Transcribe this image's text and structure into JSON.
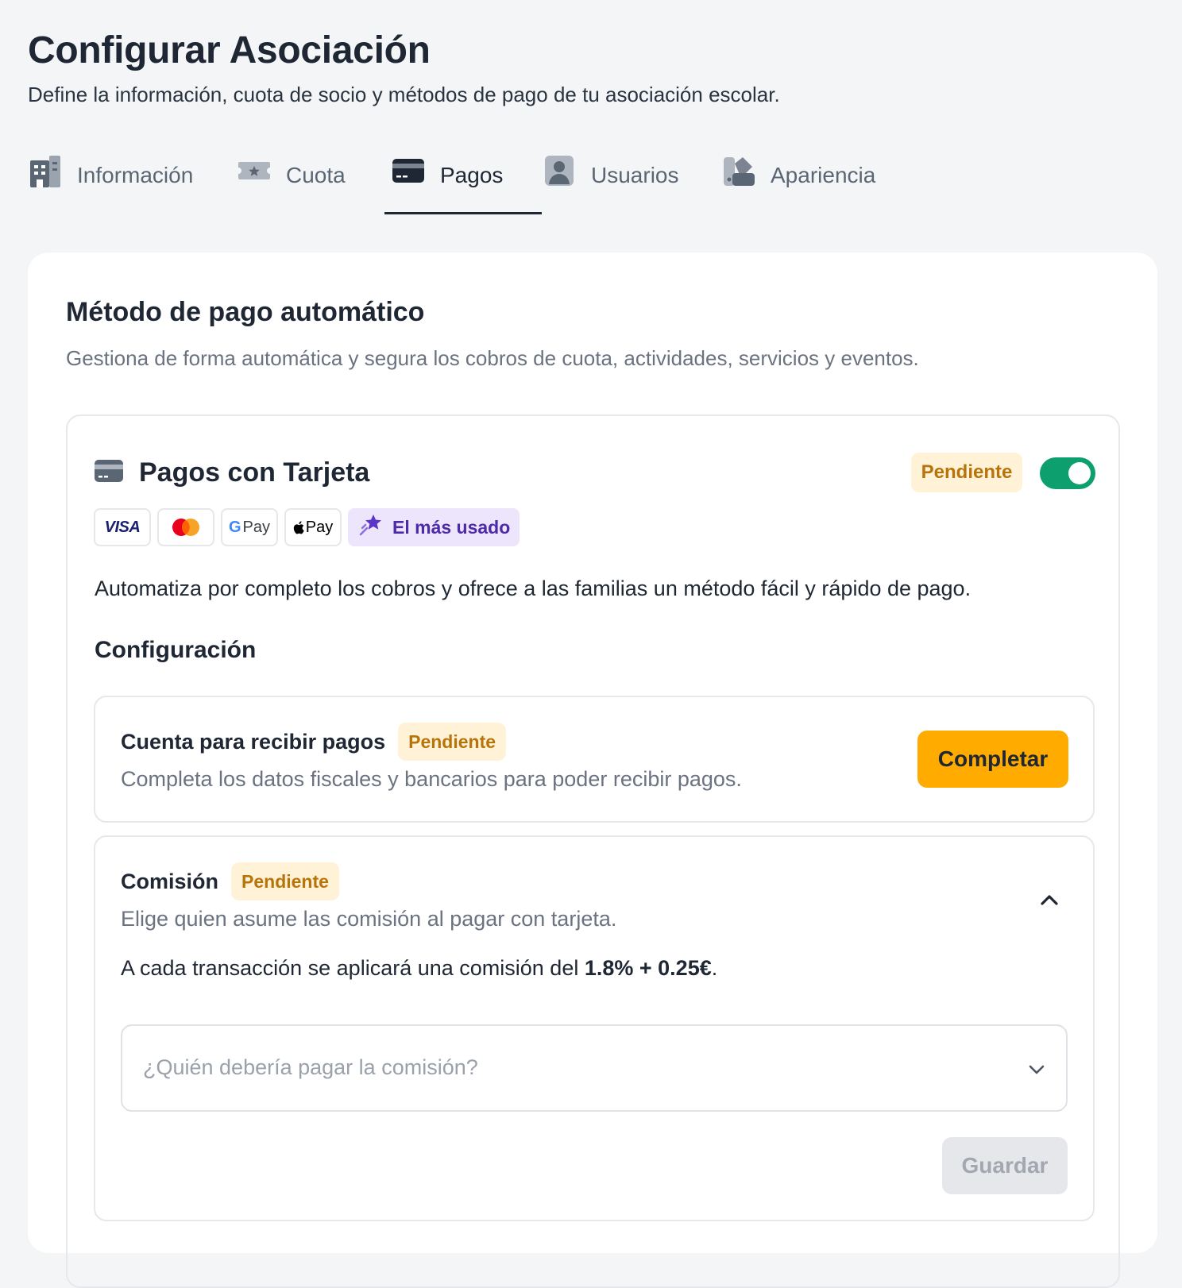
{
  "header": {
    "title": "Configurar Asociación",
    "subtitle": "Define la información, cuota de socio y métodos de pago de tu asociación escolar."
  },
  "tabs": [
    {
      "label": "Información",
      "icon": "building-icon",
      "active": false
    },
    {
      "label": "Cuota",
      "icon": "ticket-icon",
      "active": false
    },
    {
      "label": "Pagos",
      "icon": "credit-card-icon",
      "active": true
    },
    {
      "label": "Usuarios",
      "icon": "user-icon",
      "active": false
    },
    {
      "label": "Apariencia",
      "icon": "palette-icon",
      "active": false
    }
  ],
  "section": {
    "title": "Método de pago automático",
    "description": "Gestiona de forma automática y segura los cobros de cuota, actividades, servicios y eventos."
  },
  "card_payments": {
    "title": "Pagos con Tarjeta",
    "status": "Pendiente",
    "enabled": true,
    "logos": {
      "visa": "VISA",
      "mastercard": "mastercard-logo",
      "gpay": "Pay",
      "gpay_letter": "G",
      "applepay": "Pay",
      "apple_glyph": ""
    },
    "popular_label": "El más usado",
    "description": "Automatiza por completo los cobros y ofrece a las familias un método fácil y rápido de pago."
  },
  "configuration": {
    "title": "Configuración",
    "account": {
      "title": "Cuenta para recibir pagos",
      "status": "Pendiente",
      "description": "Completa los datos fiscales y bancarios para poder recibir pagos.",
      "button": "Completar"
    },
    "commission": {
      "title": "Comisión",
      "status": "Pendiente",
      "description": "Elige quien asume las comisión al pagar con tarjeta.",
      "fee_prefix": "A cada transacción se aplicará una comisión del ",
      "fee_value": "1.8% + 0.25€",
      "fee_suffix": ".",
      "select_placeholder": "¿Quién debería pagar la comisión?",
      "save_button": "Guardar"
    }
  },
  "colors": {
    "accent": "#ffab00",
    "toggle_on": "#0e9f6e",
    "badge_bg": "#fff2d6",
    "badge_text": "#b7740a",
    "popular_bg": "#ede5fb",
    "popular_text": "#4c2aa8",
    "text_dark": "#1e2733"
  }
}
